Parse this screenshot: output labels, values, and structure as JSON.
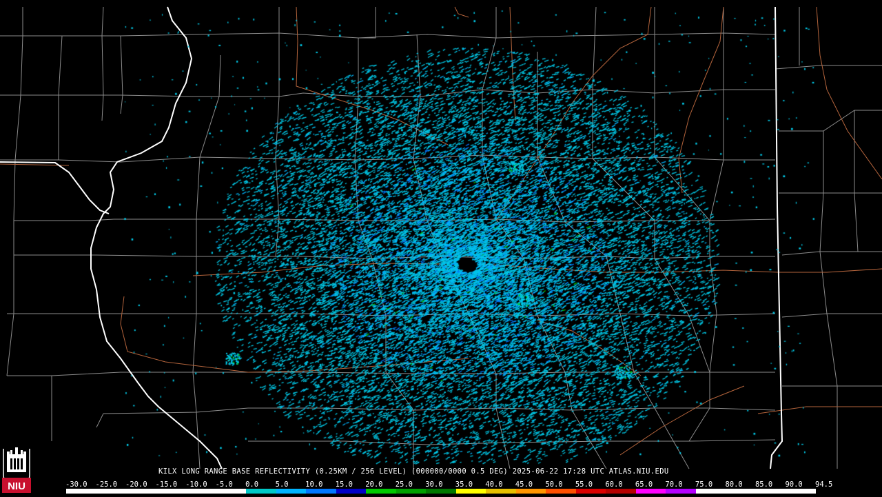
{
  "product": {
    "caption": "KILX LONG RANGE BASE REFLECTIVITY (0.25KM / 256 LEVEL) (000000/0000 0.5 DEG) 2025-06-22 17:28 UTC  ATLAS.NIU.EDU"
  },
  "logo": {
    "text": "NIU",
    "color": "#c8102e"
  },
  "scale": {
    "labels": [
      "-30.0",
      "-25.0",
      "-20.0",
      "-15.0",
      "-10.0",
      "-5.0",
      "0.0",
      "5.0",
      "10.0",
      "15.0",
      "20.0",
      "25.0",
      "30.0",
      "35.0",
      "40.0",
      "45.0",
      "50.0",
      "55.0",
      "60.0",
      "65.0",
      "70.0",
      "75.0",
      "80.0",
      "85.0",
      "90.0",
      "94.5"
    ],
    "colors": [
      "#ffffff",
      "#ffffff",
      "#ffffff",
      "#ffffff",
      "#ffffff",
      "#ffffff",
      "#00c8c8",
      "#00b4ff",
      "#0078ff",
      "#0000c8",
      "#00c800",
      "#00a000",
      "#007800",
      "#ffff00",
      "#e6c000",
      "#ff9600",
      "#ff5000",
      "#dc0000",
      "#b40000",
      "#ff00ff",
      "#b400ff",
      "#ffffff",
      "#ffffff",
      "#ffffff",
      "#ffffff"
    ]
  },
  "map": {
    "background": "#000000",
    "county_line_color": "#8c8c8c",
    "state_line_color": "#ffffff",
    "road_line_color": "#b4643c",
    "echo_colors": [
      "#00c8e6",
      "#00b4ff",
      "#0078ff",
      "#00c800"
    ]
  }
}
